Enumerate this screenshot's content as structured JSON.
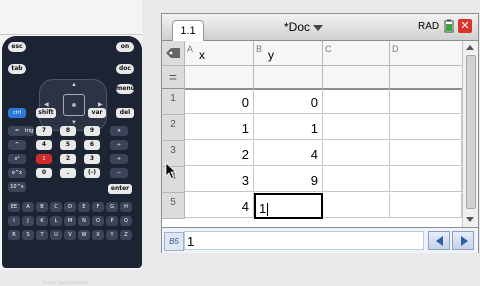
{
  "calculator": {
    "brand": "Texas Instruments",
    "keys_top": [
      "esc",
      "on",
      "tab",
      "doc",
      "menu"
    ],
    "keys_mid": [
      "ctrl",
      "shift",
      "del",
      "var"
    ],
    "keys_num": [
      "7",
      "8",
      "9",
      "4",
      "5",
      "6",
      "1",
      "2",
      "3",
      "0",
      ".",
      "(-)",
      "enter"
    ]
  },
  "app": {
    "tab_label": "1.1",
    "doc_title": "*Doc",
    "angle_mode": "RAD",
    "columns": [
      {
        "letter": "A",
        "name": "x"
      },
      {
        "letter": "B",
        "name": "y"
      },
      {
        "letter": "C",
        "name": ""
      },
      {
        "letter": "D",
        "name": ""
      }
    ],
    "formula_symbol": "=",
    "rows": [
      {
        "num": "1",
        "a": "0",
        "b": "0"
      },
      {
        "num": "2",
        "a": "1",
        "b": "1"
      },
      {
        "num": "3",
        "a": "2",
        "b": "4"
      },
      {
        "num": "4",
        "a": "3",
        "b": "9"
      },
      {
        "num": "5",
        "a": "4",
        "b": "1"
      }
    ],
    "cell_ref": "B5",
    "entry_value": "1"
  },
  "colors": {
    "close": "#d9342b",
    "accent": "#2d5fa8"
  }
}
